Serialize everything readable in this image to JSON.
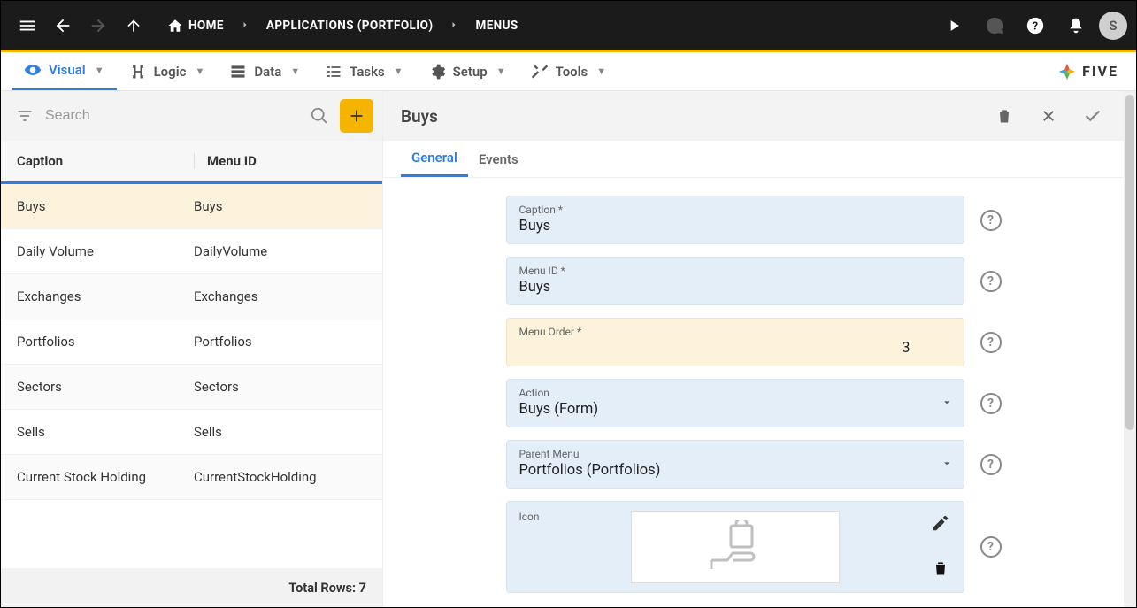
{
  "header": {
    "home": "HOME",
    "crumb2": "APPLICATIONS (PORTFOLIO)",
    "crumb3": "MENUS",
    "avatar_initial": "S"
  },
  "menu": {
    "visual": "Visual",
    "logic": "Logic",
    "data": "Data",
    "tasks": "Tasks",
    "setup": "Setup",
    "tools": "Tools",
    "brand": "FIVE"
  },
  "left": {
    "search_placeholder": "Search",
    "col_caption": "Caption",
    "col_menu_id": "Menu ID",
    "rows": [
      {
        "caption": "Buys",
        "menu_id": "Buys"
      },
      {
        "caption": "Daily Volume",
        "menu_id": "DailyVolume"
      },
      {
        "caption": "Exchanges",
        "menu_id": "Exchanges"
      },
      {
        "caption": "Portfolios",
        "menu_id": "Portfolios"
      },
      {
        "caption": "Sectors",
        "menu_id": "Sectors"
      },
      {
        "caption": "Sells",
        "menu_id": "Sells"
      },
      {
        "caption": "Current Stock Holding",
        "menu_id": "CurrentStockHolding"
      }
    ],
    "footer": "Total Rows: 7"
  },
  "detail": {
    "title": "Buys",
    "tab_general": "General",
    "tab_events": "Events",
    "caption_label": "Caption *",
    "caption_value": "Buys",
    "menuid_label": "Menu ID *",
    "menuid_value": "Buys",
    "order_label": "Menu Order *",
    "order_value": "3",
    "action_label": "Action",
    "action_value": "Buys (Form)",
    "parent_label": "Parent Menu",
    "parent_value": "Portfolios (Portfolios)",
    "icon_label": "Icon"
  }
}
